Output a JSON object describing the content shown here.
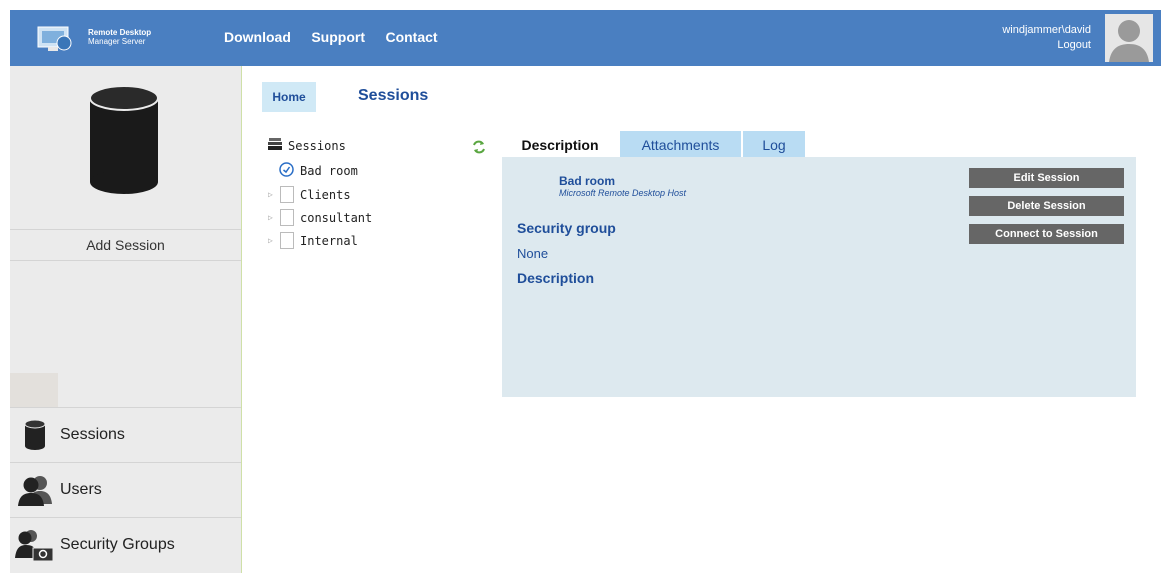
{
  "header": {
    "logo_line1": "Remote Desktop",
    "logo_line2": "Manager Server",
    "nav": [
      "Download",
      "Support",
      "Contact"
    ],
    "username": "windjammer\\david",
    "logout": "Logout"
  },
  "sidebar": {
    "add_session": "Add Session",
    "items": [
      {
        "label": "Sessions",
        "icon": "database-icon"
      },
      {
        "label": "Users",
        "icon": "users-icon"
      },
      {
        "label": "Security Groups",
        "icon": "security-group-icon"
      }
    ]
  },
  "breadcrumb": {
    "home": "Home",
    "title": "Sessions"
  },
  "tree": {
    "root": "Sessions",
    "items": [
      "Bad room",
      "Clients",
      "consultant",
      "Internal"
    ]
  },
  "tabs": [
    "Description",
    "Attachments",
    "Log"
  ],
  "detail": {
    "session_name": "Bad room",
    "session_type": "Microsoft Remote Desktop Host",
    "security_group_title": "Security group",
    "security_group_value": "None",
    "description_title": "Description"
  },
  "actions": [
    "Edit Session",
    "Delete Session",
    "Connect to Session"
  ],
  "colors": {
    "header": "#4a7fc1",
    "sidebar": "#ebebeb",
    "panel": "#dde9ef",
    "tab_inactive": "#b9dcf3",
    "accent_text": "#1f4e9a",
    "action_button": "#666666"
  }
}
